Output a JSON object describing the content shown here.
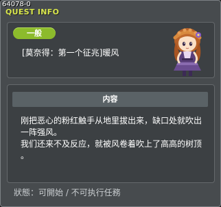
{
  "window": {
    "quest_id": "64078-0",
    "title": "QUEST INFO"
  },
  "quest": {
    "category_badge": "一般",
    "name": "[莫奈得：第一个征兆]暖风"
  },
  "content": {
    "header": "内容",
    "lines": [
      "刚把恶心的粉红触手从地里拔出来，缺口处就吹出",
      "一阵强风。",
      "我们还来不及反应，就被风卷着吹上了高高的树顶",
      "。"
    ]
  },
  "status": {
    "text": "狀態：可開始 / 不可执行任務"
  },
  "colors": {
    "title": "#d8e64c",
    "badge": "#8cbb2c",
    "panel": "#3c4043",
    "window": "#474b4e"
  }
}
